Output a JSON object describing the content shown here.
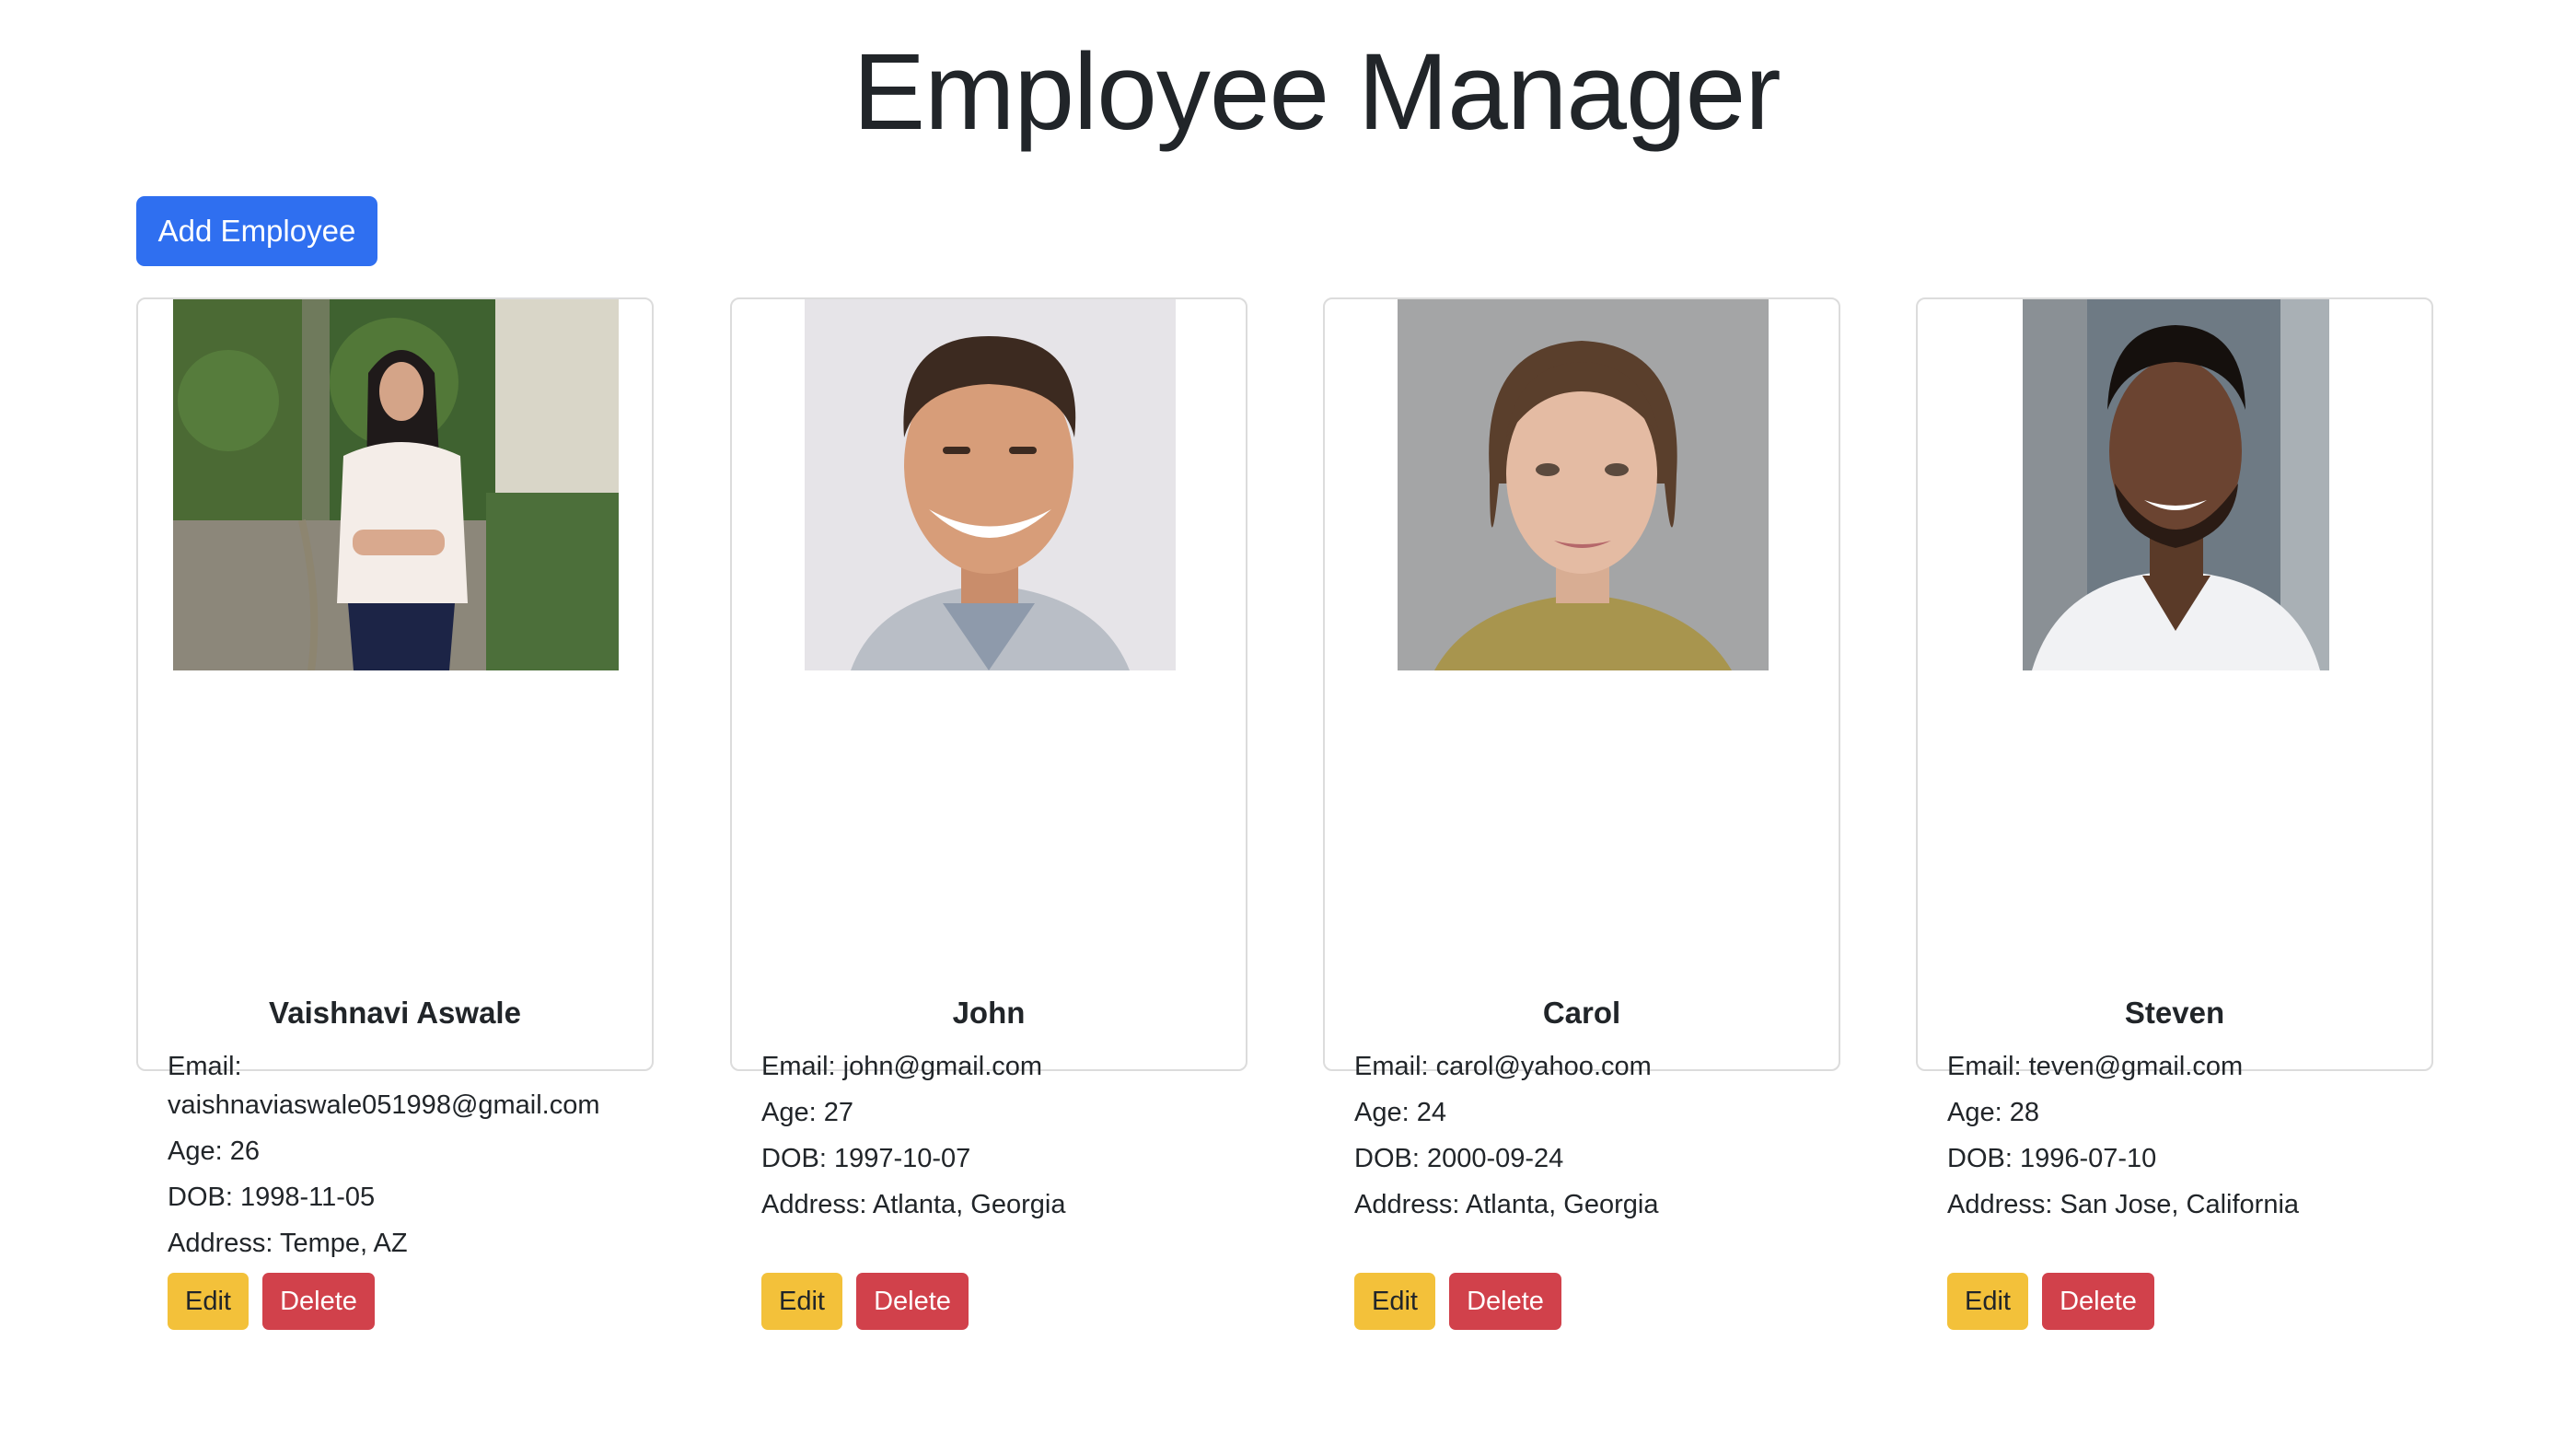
{
  "page": {
    "title": "Employee Manager"
  },
  "toolbar": {
    "add_label": "Add Employee"
  },
  "colors": {
    "primary": "#2f6ff0",
    "warning": "#f3c13a",
    "danger": "#d1414b",
    "card_border": "#dcdcdc"
  },
  "employees": [
    {
      "name": "Vaishnavi Aswale",
      "email_label": "Email:",
      "email": "vaishnaviaswale051998@gmail.com",
      "age": "Age: 26",
      "dob": "DOB: 1998-11-05",
      "address": "Address: Tempe, AZ",
      "edit_label": "Edit",
      "delete_label": "Delete"
    },
    {
      "name": "John",
      "email": "Email: john@gmail.com",
      "age": "Age: 27",
      "dob": "DOB: 1997-10-07",
      "address": "Address: Atlanta, Georgia",
      "edit_label": "Edit",
      "delete_label": "Delete"
    },
    {
      "name": "Carol",
      "email": "Email: carol@yahoo.com",
      "age": "Age: 24",
      "dob": "DOB: 2000-09-24",
      "address": "Address: Atlanta, Georgia",
      "edit_label": "Edit",
      "delete_label": "Delete"
    },
    {
      "name": "Steven",
      "email": "Email: teven@gmail.com",
      "age": "Age: 28",
      "dob": "DOB: 1996-07-10",
      "address": "Address: San Jose, California",
      "edit_label": "Edit",
      "delete_label": "Delete"
    }
  ]
}
